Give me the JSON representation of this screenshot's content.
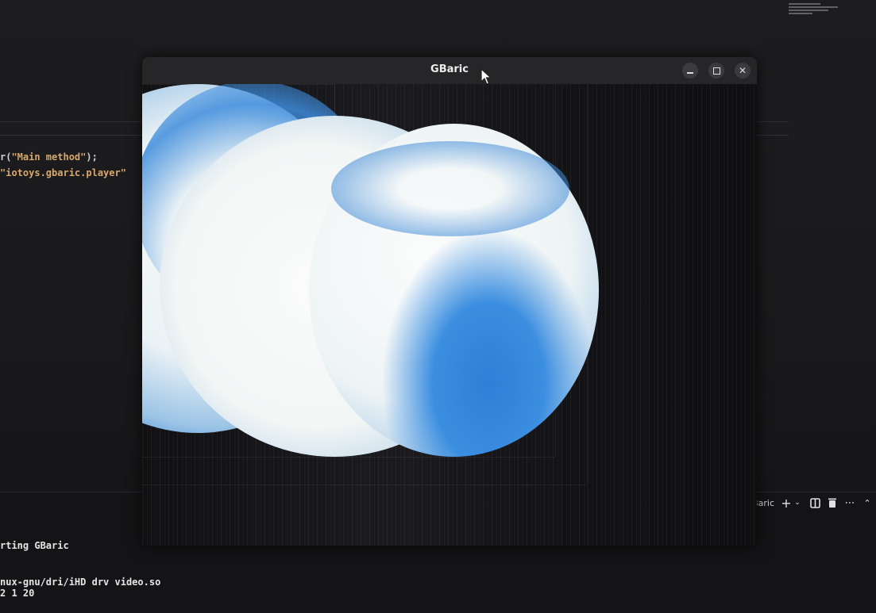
{
  "window": {
    "title": "GBaric",
    "controls": {
      "minimize": "minimize-icon",
      "maximize": "maximize-icon",
      "close": "close-icon"
    }
  },
  "editor": {
    "code_lines": [
      {
        "prefix": "r(",
        "string": "\"Main method\"",
        "suffix": ");"
      },
      {
        "prefix": "",
        "string": "\"iotoys.gbaric.player\"",
        "suffix": ""
      }
    ]
  },
  "panel": {
    "debug_target": "cppdbg: GBaric",
    "icons": [
      "gear-icon",
      "add-icon",
      "chevron-down-icon",
      "split-icon",
      "trash-icon",
      "more-icon",
      "chevron-up-icon"
    ]
  },
  "terminal": {
    "lines": [
      "rting GBaric",
      "",
      "nux-gnu/dri/iHD drv video.so",
      "2 1 20"
    ]
  },
  "colors": {
    "window_titlebar": "#262628",
    "code_string": "#d7a86e",
    "globe_blue": "#2f7fd6",
    "globe_white": "#f4f7f6"
  }
}
